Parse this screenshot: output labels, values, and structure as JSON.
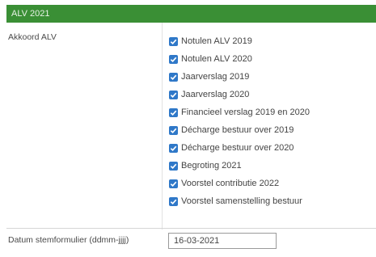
{
  "header": {
    "title": "ALV 2021"
  },
  "agenda": {
    "label": "Akkoord ALV",
    "items": [
      {
        "label": "Notulen ALV 2019",
        "checked": true
      },
      {
        "label": "Notulen ALV 2020",
        "checked": true
      },
      {
        "label": "Jaarverslag 2019",
        "checked": true
      },
      {
        "label": "Jaarverslag 2020",
        "checked": true
      },
      {
        "label": "Financieel verslag 2019 en 2020",
        "checked": true
      },
      {
        "label": "Décharge bestuur over 2019",
        "checked": true
      },
      {
        "label": "Décharge bestuur over 2020",
        "checked": true
      },
      {
        "label": "Begroting 2021",
        "checked": true
      },
      {
        "label": "Voorstel contributie 2022",
        "checked": true
      },
      {
        "label": "Voorstel samenstelling bestuur",
        "checked": true
      }
    ]
  },
  "date_field": {
    "label": "Datum stemformulier (ddmm-jjjj)",
    "value": "16-03-2021"
  },
  "colors": {
    "header_bg": "#3a8f35",
    "checkbox": "#2f78c8"
  }
}
